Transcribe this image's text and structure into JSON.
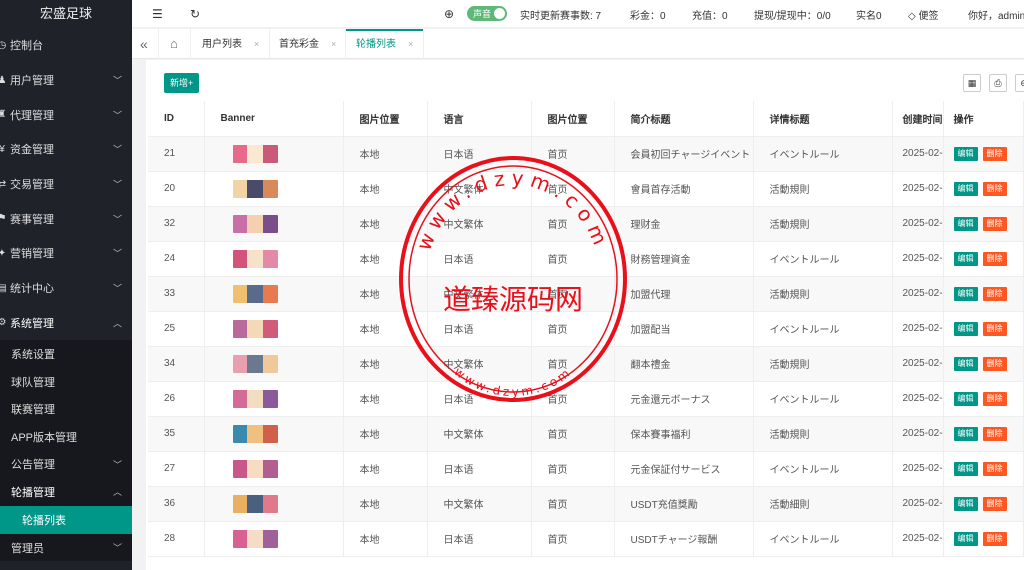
{
  "app": {
    "title": "宏盛足球"
  },
  "sidebar": {
    "items": [
      {
        "label": "控制台",
        "chev": ""
      },
      {
        "label": "用户管理",
        "chev": "﹀"
      },
      {
        "label": "代理管理",
        "chev": "﹀"
      },
      {
        "label": "资金管理",
        "chev": "﹀"
      },
      {
        "label": "交易管理",
        "chev": "﹀"
      },
      {
        "label": "赛事管理",
        "chev": "﹀"
      },
      {
        "label": "营销管理",
        "chev": "﹀"
      },
      {
        "label": "统计中心",
        "chev": "﹀"
      },
      {
        "label": "系统管理",
        "chev": "︿"
      }
    ],
    "sub_items": [
      {
        "label": "系统设置",
        "chev": ""
      },
      {
        "label": "球队管理",
        "chev": ""
      },
      {
        "label": "联赛管理",
        "chev": ""
      },
      {
        "label": "APP版本管理",
        "chev": ""
      },
      {
        "label": "公告管理",
        "chev": "﹀"
      },
      {
        "label": "轮播管理",
        "chev": "︿"
      }
    ],
    "active_sub": "轮播列表",
    "tail_item": {
      "label": "管理员",
      "chev": "﹀"
    }
  },
  "header": {
    "menu_icon": "☰",
    "refresh_icon": "↻",
    "globe_icon": "⊕",
    "sound_label": "声音",
    "realtime_label": "实时更新赛事数: 7",
    "lottery_label": "彩金：0",
    "recharge_label": "充值：0",
    "withdraw_label": "提现/提现中：0/0",
    "realname_label": "实名0",
    "note_icon": "◇",
    "note_label": "便签",
    "greeting": "你好，admin"
  },
  "tabs": {
    "back_icon": "«",
    "home_icon": "⌂",
    "items": [
      {
        "label": "用户列表",
        "close": "×"
      },
      {
        "label": "首充彩金",
        "close": "×"
      },
      {
        "label": "轮播列表",
        "close": "×"
      }
    ]
  },
  "toolbar": {
    "add_label": "新增+",
    "columns_icon": "▦",
    "print_icon": "⎙",
    "export_icon": "⊖"
  },
  "table": {
    "headers": [
      "ID",
      "Banner",
      "图片位置",
      "语言",
      "图片位置",
      "简介标题",
      "详情标题",
      "创建时间",
      "操作"
    ],
    "edit_label": "编辑",
    "delete_label": "删除",
    "rows": [
      {
        "id": "21",
        "loc": "本地",
        "lang": "日本语",
        "pos": "首页",
        "intro": "会員初回チャージイベント",
        "detail": "イベントルール",
        "time": "2025-02-"
      },
      {
        "id": "20",
        "loc": "本地",
        "lang": "中文繁体",
        "pos": "首页",
        "intro": "會員首存活動",
        "detail": "活動規則",
        "time": "2025-02-"
      },
      {
        "id": "32",
        "loc": "本地",
        "lang": "中文繁体",
        "pos": "首页",
        "intro": "理财金",
        "detail": "活動規則",
        "time": "2025-02-"
      },
      {
        "id": "24",
        "loc": "本地",
        "lang": "日本语",
        "pos": "首页",
        "intro": "財務管理資金",
        "detail": "イベントルール",
        "time": "2025-02-"
      },
      {
        "id": "33",
        "loc": "本地",
        "lang": "中文繁体",
        "pos": "首页",
        "intro": "加盟代理",
        "detail": "活動規則",
        "time": "2025-02-"
      },
      {
        "id": "25",
        "loc": "本地",
        "lang": "日本语",
        "pos": "首页",
        "intro": "加盟配当",
        "detail": "イベントルール",
        "time": "2025-02-"
      },
      {
        "id": "34",
        "loc": "本地",
        "lang": "中文繁体",
        "pos": "首页",
        "intro": "翻本禮金",
        "detail": "活動規則",
        "time": "2025-02-"
      },
      {
        "id": "26",
        "loc": "本地",
        "lang": "日本语",
        "pos": "首页",
        "intro": "元金還元ボーナス",
        "detail": "イベントルール",
        "time": "2025-02-"
      },
      {
        "id": "35",
        "loc": "本地",
        "lang": "中文繁体",
        "pos": "首页",
        "intro": "保本賽事福利",
        "detail": "活動規則",
        "time": "2025-02-"
      },
      {
        "id": "27",
        "loc": "本地",
        "lang": "日本语",
        "pos": "首页",
        "intro": "元金保証付サービス",
        "detail": "イベントルール",
        "time": "2025-02-"
      },
      {
        "id": "36",
        "loc": "本地",
        "lang": "中文繁体",
        "pos": "首页",
        "intro": "USDT充值獎勵",
        "detail": "活動細則",
        "time": "2025-02-"
      },
      {
        "id": "28",
        "loc": "本地",
        "lang": "日本语",
        "pos": "首页",
        "intro": "USDTチャージ報酬",
        "detail": "イベントルール",
        "time": "2025-02-"
      }
    ]
  },
  "watermark": {
    "main_text": "道臻源码网",
    "top_arc": "www.dzym.com",
    "bottom_arc": "www.dzym.com",
    "color": "#e8101a"
  }
}
